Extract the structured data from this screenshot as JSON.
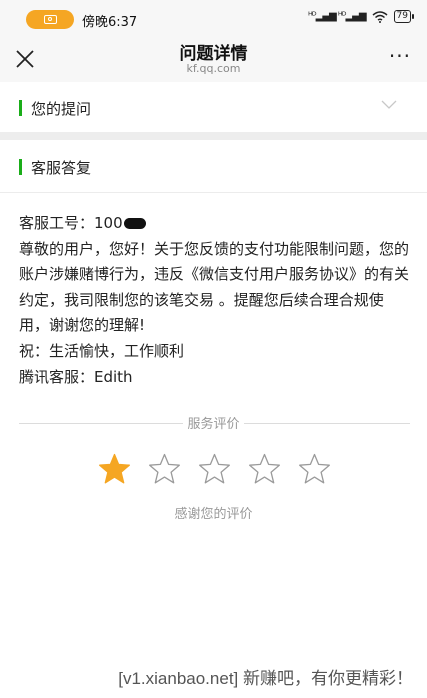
{
  "status_bar": {
    "time": "傍晚6:37",
    "signal": "HD",
    "battery": "79"
  },
  "nav": {
    "title": "问题详情",
    "subtitle": "kf.qq.com",
    "more": "···"
  },
  "sections": {
    "question": {
      "label": "您的提问"
    },
    "answer": {
      "label": "客服答复"
    }
  },
  "reply": {
    "staff_id_prefix": "客服工号：100",
    "body": "尊敬的用户，您好！关于您反馈的支付功能限制问题，您的账户涉嫌赌博行为，违反《微信支付用户服务协议》的有关约定，我司限制您的该笔交易 。提醒您后续合理合规使用，谢谢您的理解!",
    "wish": "祝：生活愉快，工作顺利",
    "signature": "腾讯客服：Edith"
  },
  "rating": {
    "title": "服务评价",
    "stars": 1,
    "max_stars": 5,
    "thanks": "感谢您的评价",
    "accent": "#f5a623"
  },
  "watermark": "[v1.xianbao.net] 新赚吧，有你更精彩！"
}
